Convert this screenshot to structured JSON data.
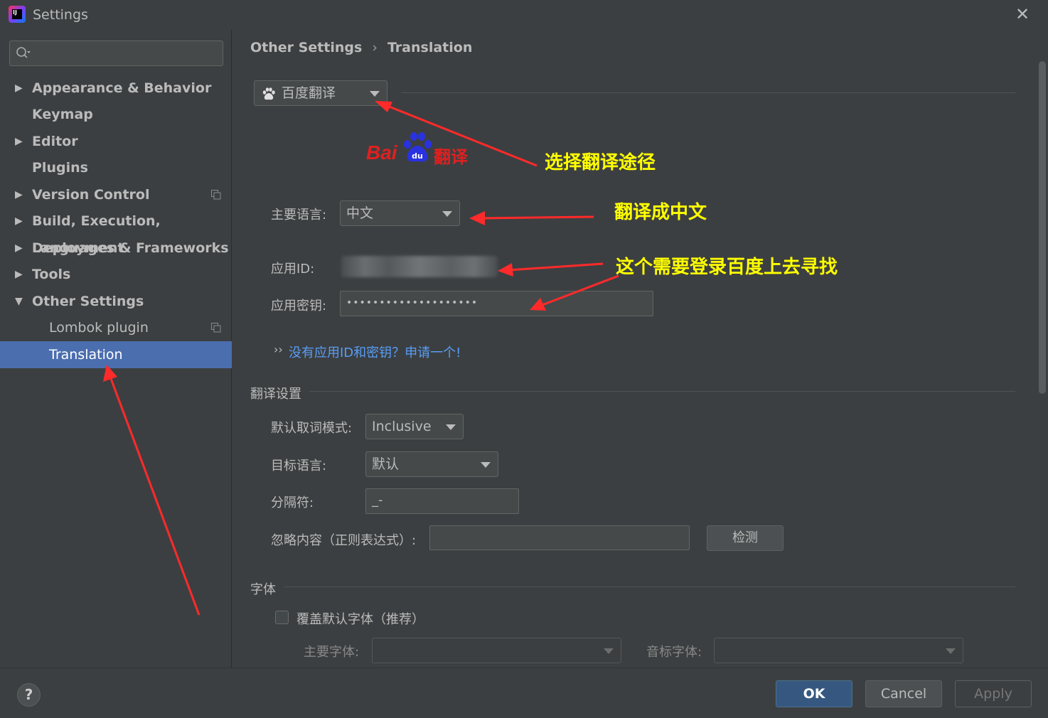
{
  "window": {
    "title": "Settings",
    "close": "✕"
  },
  "sidebar": {
    "search_placeholder": "",
    "items": [
      {
        "label": "Appearance & Behavior",
        "expandable": true,
        "arrow": "▶"
      },
      {
        "label": "Keymap",
        "expandable": false
      },
      {
        "label": "Editor",
        "expandable": true,
        "arrow": "▶"
      },
      {
        "label": "Plugins",
        "expandable": false
      },
      {
        "label": "Version Control",
        "expandable": true,
        "arrow": "▶"
      },
      {
        "label": "Build, Execution, Deployment",
        "expandable": true,
        "arrow": "▶"
      },
      {
        "label": "Languages & Frameworks",
        "expandable": true,
        "arrow": "▶"
      },
      {
        "label": "Tools",
        "expandable": true,
        "arrow": "▶"
      },
      {
        "label": "Other Settings",
        "expandable": true,
        "expanded": true,
        "arrow": "▼"
      },
      {
        "label": "Lombok plugin",
        "child": true
      },
      {
        "label": "Translation",
        "child": true,
        "selected": true
      }
    ]
  },
  "breadcrumb": {
    "parent": "Other Settings",
    "separator": "›",
    "current": "Translation"
  },
  "translator": {
    "engine_label": "百度翻译",
    "logo_text": "Bai",
    "logo_suffix": "翻译"
  },
  "form": {
    "primary_language_label": "主要语言:",
    "primary_language_value": "中文",
    "app_id_label": "应用ID:",
    "app_key_label": "应用密钥:",
    "app_key_value": "••••••••••••••••••••",
    "link_arrow": "››",
    "apply_link": "没有应用ID和密钥？申请一个!"
  },
  "translation_settings": {
    "title": "翻译设置",
    "word_mode_label": "默认取词模式:",
    "word_mode_value": "Inclusive",
    "target_language_label": "目标语言:",
    "target_language_value": "默认",
    "separator_label": "分隔符:",
    "separator_value": "_-",
    "ignore_label": "忽略内容（正则表达式）:",
    "ignore_value": "",
    "check_button": "检测"
  },
  "font": {
    "title": "字体",
    "override_label": "覆盖默认字体（推荐）",
    "override_checked": false,
    "primary_font_label": "主要字体:",
    "phonetic_font_label": "音标字体:"
  },
  "annotations": {
    "select_engine": "选择翻译途径",
    "translate_to_chinese": "翻译成中文",
    "need_login": "这个需要登录百度上去寻找",
    "color": "#ffff00",
    "arrow_color": "#ff2a2a"
  },
  "buttons": {
    "help": "?",
    "ok": "OK",
    "cancel": "Cancel",
    "apply": "Apply"
  },
  "colors": {
    "background": "#3c3f41",
    "selection": "#4b6eaf",
    "link": "#589df6",
    "ok_button": "#365880"
  }
}
